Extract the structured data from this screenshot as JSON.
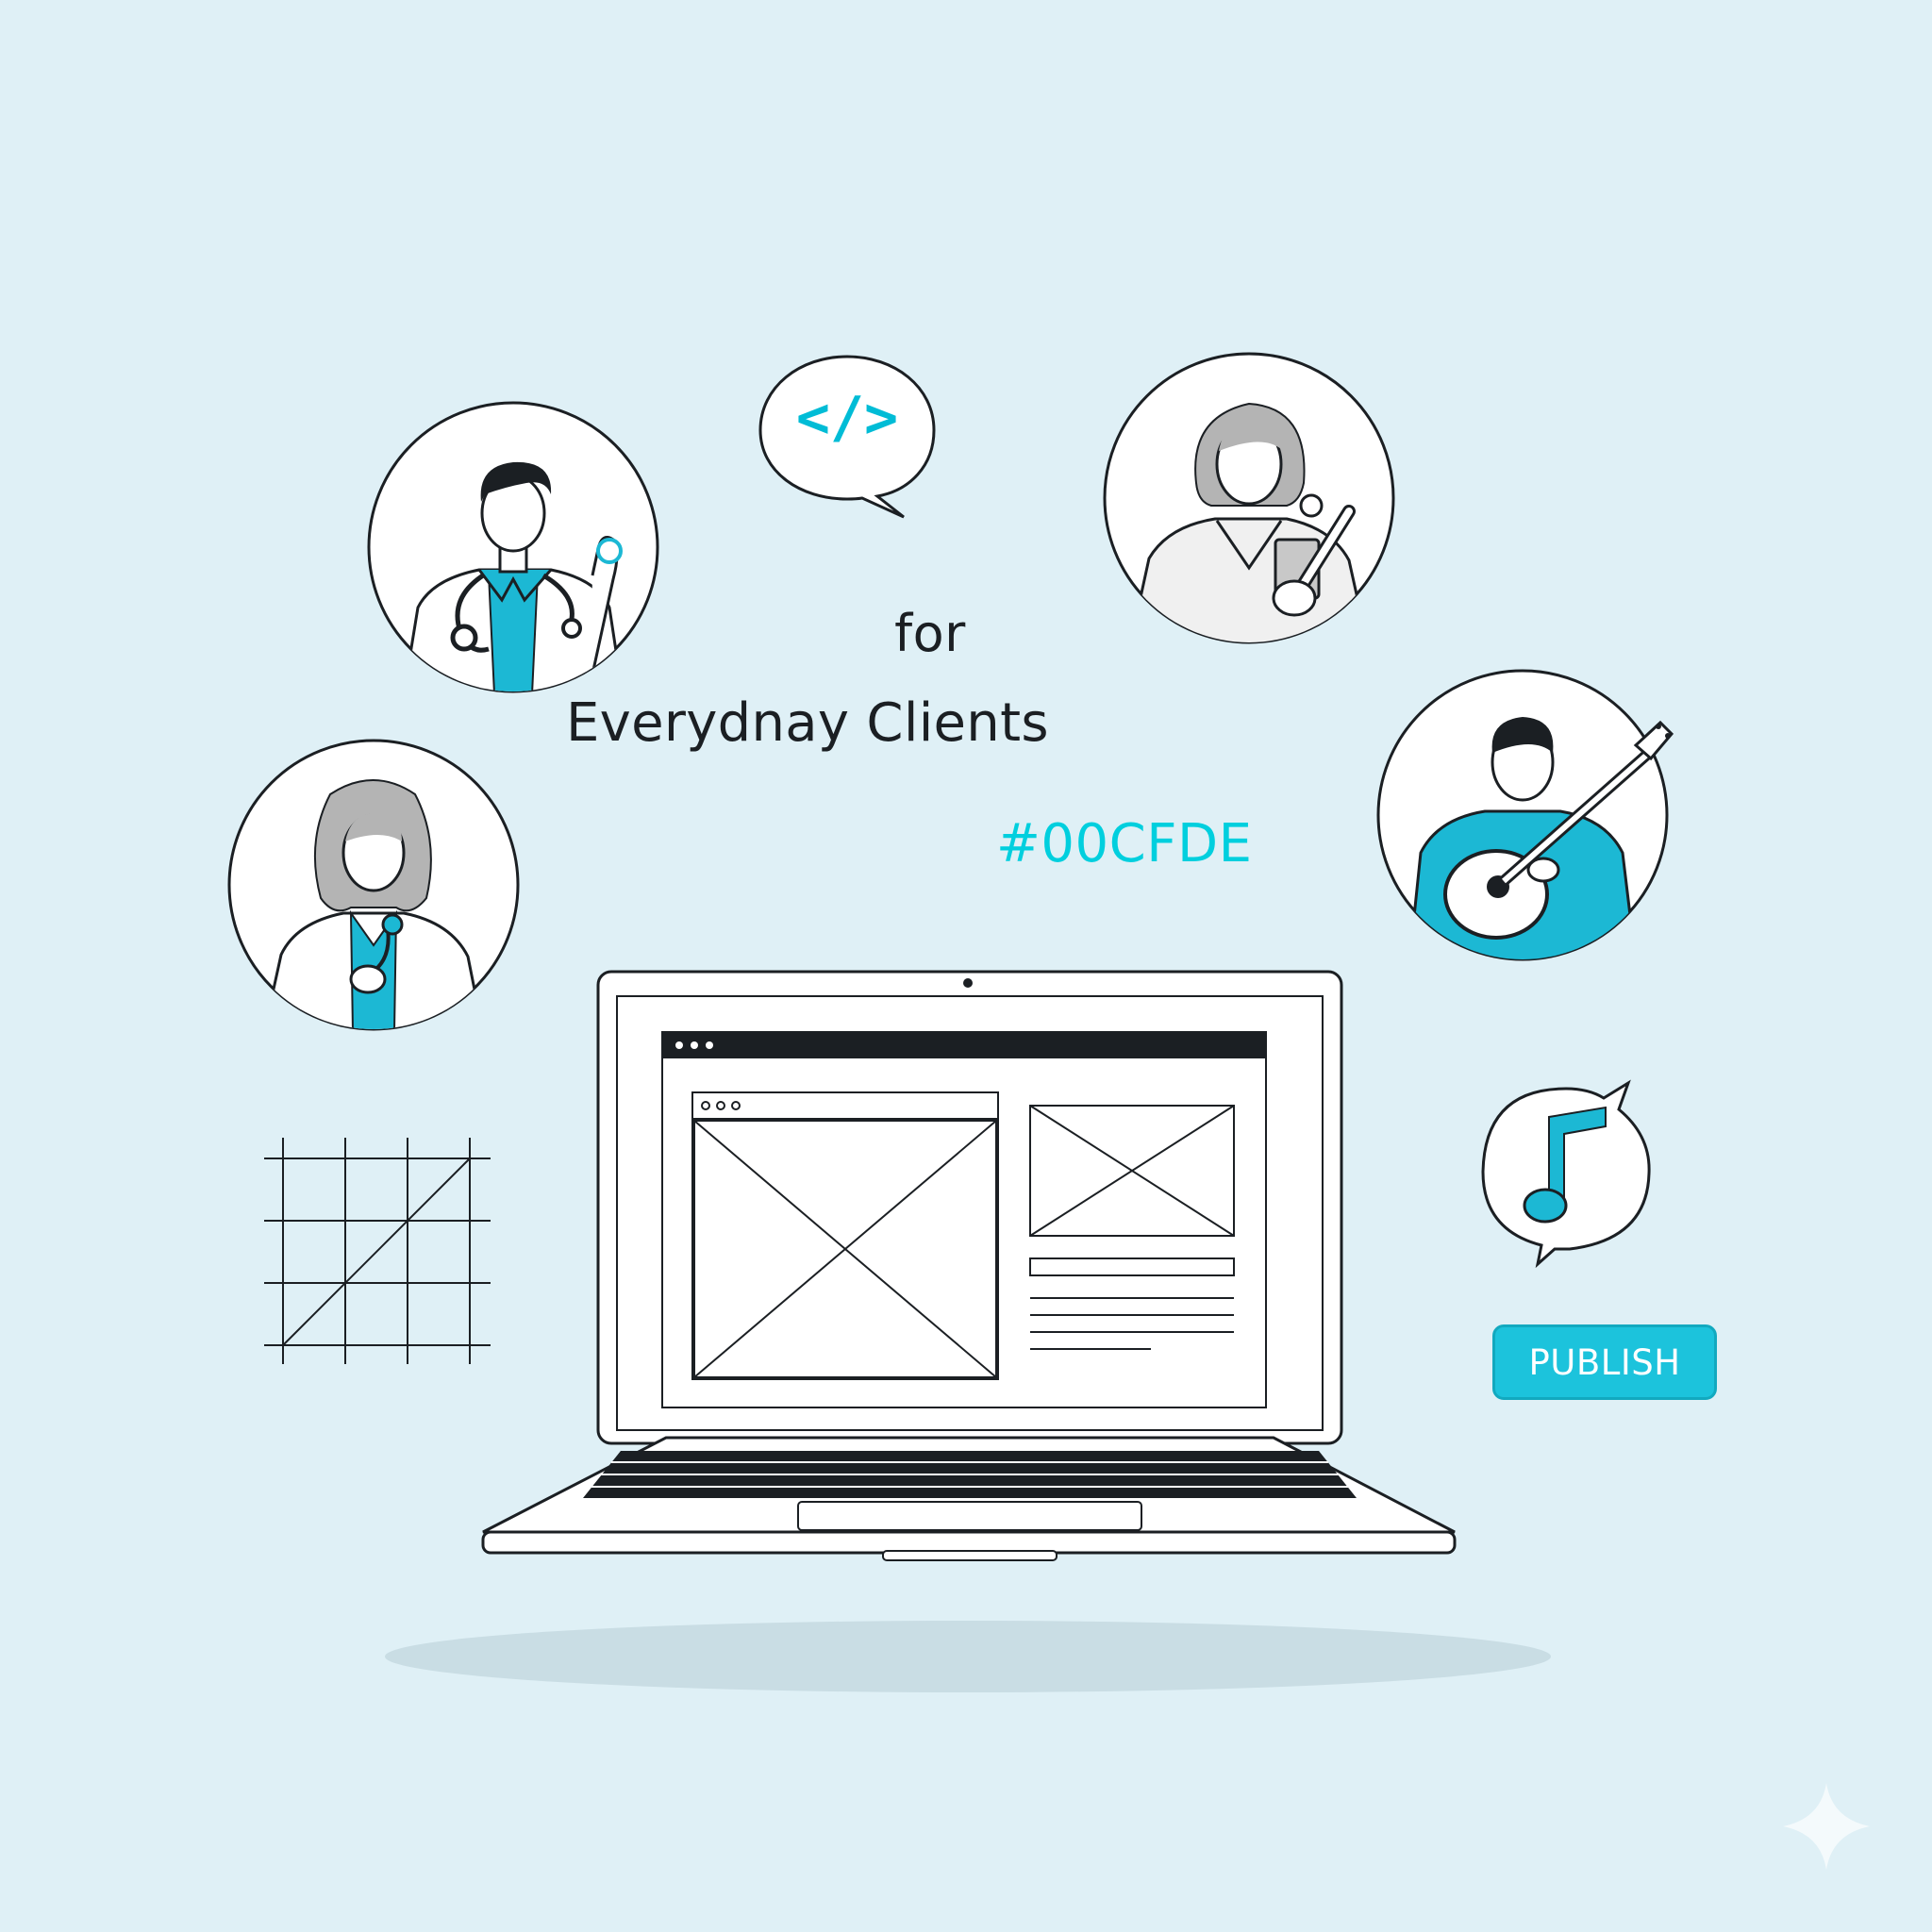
{
  "headline": {
    "line1": "for",
    "line2": "Everydnay Clients"
  },
  "accent_label": "#00CFDE",
  "code_bubble": {
    "glyph": "</>",
    "icon": "code-icon"
  },
  "music_bubble": {
    "icon": "music-note-icon"
  },
  "publish_button": {
    "label": "PUBLISH"
  },
  "avatars": [
    {
      "name": "doctor-man",
      "icon": "doctor-avatar-icon"
    },
    {
      "name": "teacher-woman",
      "icon": "teacher-avatar-icon"
    },
    {
      "name": "doctor-woman",
      "icon": "doctor-woman-avatar-icon"
    },
    {
      "name": "guitarist",
      "icon": "guitarist-avatar-icon"
    }
  ],
  "colors": {
    "background": "#dff0f6",
    "accent": "#00CFDE",
    "ink": "#1b1f23"
  }
}
